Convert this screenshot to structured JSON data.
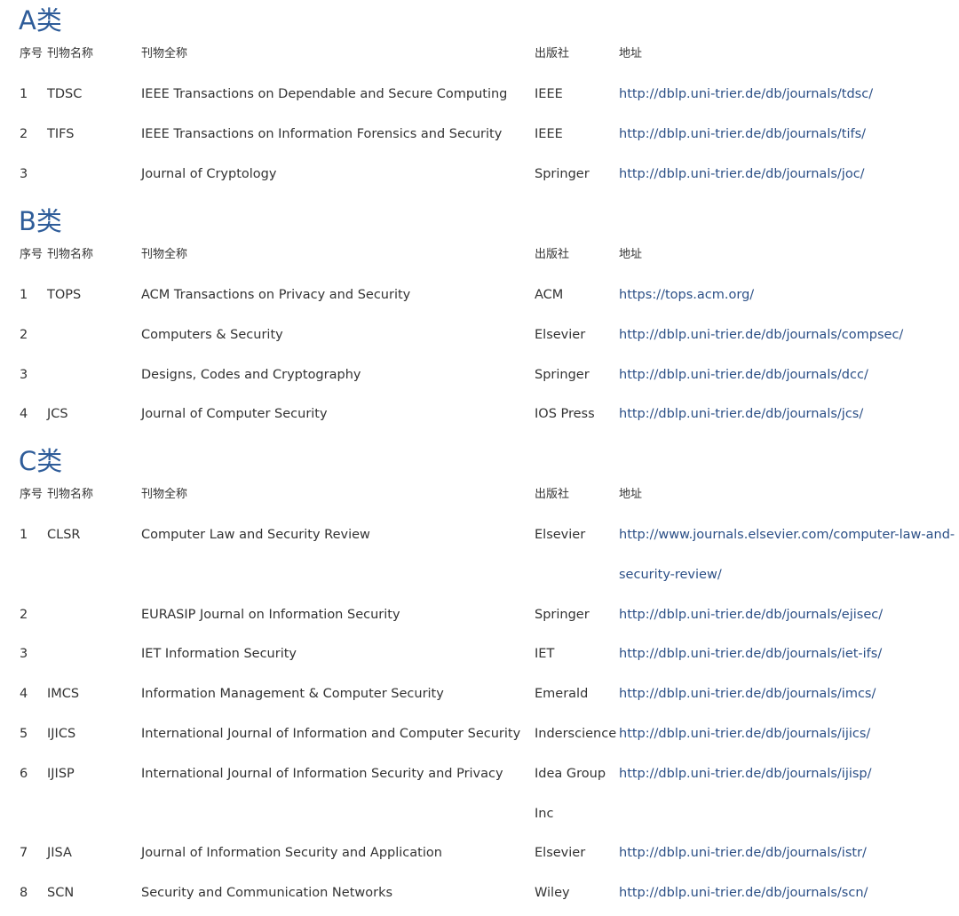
{
  "header_labels": {
    "index": "序号",
    "abbr": "刊物名称",
    "full_name": "刊物全称",
    "publisher": "出版社",
    "url": "地址"
  },
  "sections": [
    {
      "title": "A类",
      "rows": [
        {
          "index": "1",
          "abbr": "TDSC",
          "full_name": "IEEE Transactions on Dependable and Secure Computing",
          "publisher": [
            "IEEE"
          ],
          "url": [
            "http://dblp.uni-trier.de/db/journals/tdsc/"
          ]
        },
        {
          "index": "2",
          "abbr": "TIFS",
          "full_name": "IEEE Transactions on Information Forensics and Security",
          "publisher": [
            "IEEE"
          ],
          "url": [
            "http://dblp.uni-trier.de/db/journals/tifs/"
          ]
        },
        {
          "index": "3",
          "abbr": "",
          "full_name": "Journal of Cryptology",
          "publisher": [
            "Springer"
          ],
          "url": [
            "http://dblp.uni-trier.de/db/journals/joc/"
          ]
        }
      ]
    },
    {
      "title": "B类",
      "rows": [
        {
          "index": "1",
          "abbr": "TOPS",
          "full_name": "ACM Transactions on Privacy and Security",
          "publisher": [
            "ACM"
          ],
          "url": [
            "https://tops.acm.org/"
          ]
        },
        {
          "index": "2",
          "abbr": "",
          "full_name": "Computers & Security",
          "publisher": [
            "Elsevier"
          ],
          "url": [
            "http://dblp.uni-trier.de/db/journals/compsec/"
          ]
        },
        {
          "index": "3",
          "abbr": "",
          "full_name": "Designs, Codes and Cryptography",
          "publisher": [
            "Springer"
          ],
          "url": [
            "http://dblp.uni-trier.de/db/journals/dcc/"
          ]
        },
        {
          "index": "4",
          "abbr": "JCS",
          "full_name": "Journal of Computer Security",
          "publisher": [
            "IOS Press"
          ],
          "url": [
            "http://dblp.uni-trier.de/db/journals/jcs/"
          ]
        }
      ]
    },
    {
      "title": "C类",
      "rows": [
        {
          "index": "1",
          "abbr": "CLSR",
          "full_name": "Computer Law and Security Review",
          "publisher": [
            "Elsevier"
          ],
          "url": [
            "http://www.journals.elsevier.com/computer-law-and-",
            "security-review/"
          ]
        },
        {
          "index": "2",
          "abbr": "",
          "full_name": "EURASIP Journal on Information Security",
          "publisher": [
            "Springer"
          ],
          "url": [
            "http://dblp.uni-trier.de/db/journals/ejisec/"
          ]
        },
        {
          "index": "3",
          "abbr": "",
          "full_name": "IET Information Security",
          "publisher": [
            "IET"
          ],
          "url": [
            "http://dblp.uni-trier.de/db/journals/iet-ifs/"
          ]
        },
        {
          "index": "4",
          "abbr": "IMCS",
          "full_name": "Information Management & Computer Security",
          "publisher": [
            "Emerald"
          ],
          "url": [
            "http://dblp.uni-trier.de/db/journals/imcs/"
          ]
        },
        {
          "index": "5",
          "abbr": "IJICS",
          "full_name": "International Journal of Information and Computer Security",
          "publisher": [
            "Inderscience"
          ],
          "url": [
            "http://dblp.uni-trier.de/db/journals/ijics/"
          ]
        },
        {
          "index": "6",
          "abbr": "IJISP",
          "full_name": "International Journal of Information Security and Privacy",
          "publisher": [
            "Idea Group",
            "Inc"
          ],
          "url": [
            "http://dblp.uni-trier.de/db/journals/ijisp/"
          ]
        },
        {
          "index": "7",
          "abbr": "JISA",
          "full_name": "Journal of Information Security and Application",
          "publisher": [
            "Elsevier"
          ],
          "url": [
            "http://dblp.uni-trier.de/db/journals/istr/"
          ]
        },
        {
          "index": "8",
          "abbr": "SCN",
          "full_name": "Security and Communication Networks",
          "publisher": [
            "Wiley"
          ],
          "url": [
            "http://dblp.uni-trier.de/db/journals/scn/"
          ]
        }
      ]
    }
  ],
  "colors": {
    "heading": "#2e5c99",
    "text": "#333333",
    "link": "#2b4f86"
  }
}
